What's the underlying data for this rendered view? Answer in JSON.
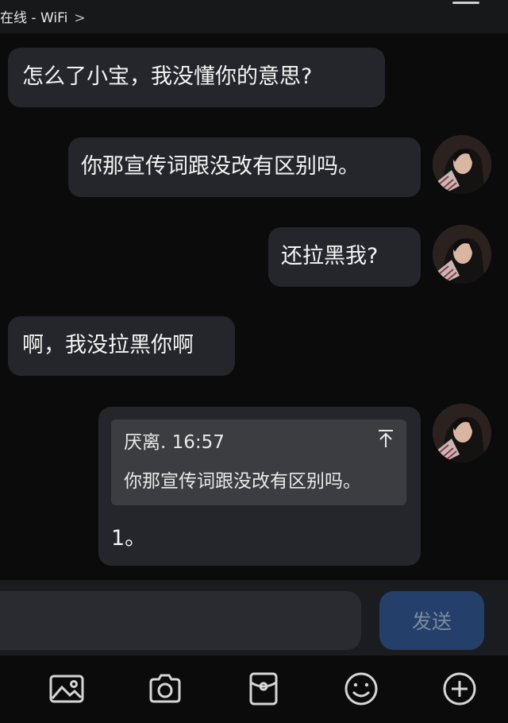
{
  "status_bar": {
    "text": "在线 - WiFi",
    "chevron": ">"
  },
  "messages": [
    {
      "side": "left",
      "text": "怎么了小宝，我没懂你的意思?"
    },
    {
      "side": "right",
      "text": "你那宣传词跟没改有区别吗。"
    },
    {
      "side": "right",
      "text": "还拉黑我?"
    },
    {
      "side": "left",
      "text": "啊，我没拉黑你啊"
    },
    {
      "side": "right",
      "quote": {
        "header": "厌离. 16:57",
        "text": "你那宣传词跟没改有区别吗。",
        "icon": "arrow-to-top-icon"
      },
      "text": "1。"
    }
  ],
  "composer": {
    "input_value": "",
    "send_label": "发送"
  },
  "toolbar": {
    "items": [
      "image-icon",
      "camera-icon",
      "red-packet-icon",
      "emoji-icon",
      "plus-icon"
    ]
  },
  "colors": {
    "background": "#0b0b0c",
    "bubble": "#25262b",
    "quote": "#3b3d41",
    "send_button": "#243f6a"
  }
}
